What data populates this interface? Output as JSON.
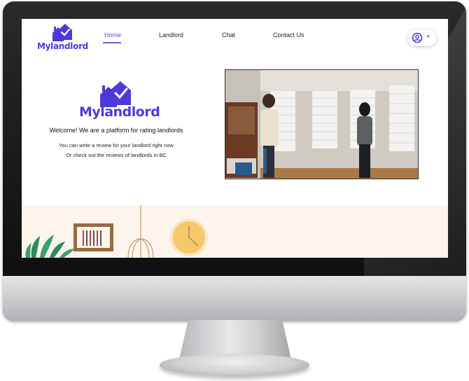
{
  "brand": {
    "name": "Mylandlord",
    "color": "#4a3bd8"
  },
  "nav": {
    "items": [
      {
        "label": "Home",
        "active": true
      },
      {
        "label": "Landlord",
        "active": false
      },
      {
        "label": "Chat",
        "active": false
      },
      {
        "label": "Contact Us",
        "active": false
      }
    ]
  },
  "user_menu": {
    "icon": "user-circle-icon",
    "dropdown_icon": "chevron-down-icon"
  },
  "hero": {
    "logo_text": "Mylandlord",
    "welcome": "Welcome! We are a platform for rating landlords",
    "line1": "You can write a review for your landlord right now",
    "line2": "Or check out the reviews of landlords in BC"
  },
  "media": {
    "type": "video-still",
    "description_icon": "two-people-room-photo"
  },
  "banner": {
    "background": "#fdf5ec"
  }
}
